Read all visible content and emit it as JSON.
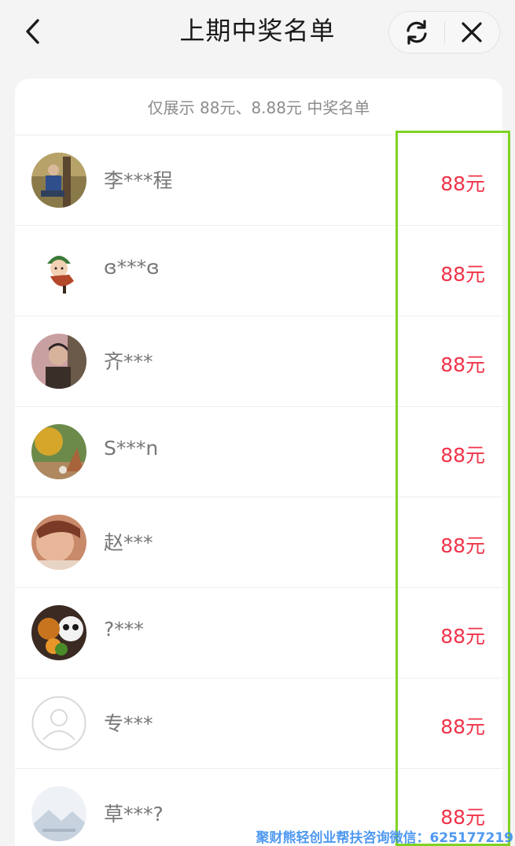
{
  "header": {
    "title": "上期中奖名单"
  },
  "note": "仅展示 88元、8.88元 中奖名单",
  "winners": [
    {
      "name": "李***程",
      "amount": "88元",
      "avatar": "photo-man-outdoor"
    },
    {
      "name": "ɞ***ɞ",
      "amount": "88元",
      "avatar": "cartoon-girl"
    },
    {
      "name": "齐***",
      "amount": "88元",
      "avatar": "photo-woman-portrait"
    },
    {
      "name": "S***n",
      "amount": "88元",
      "avatar": "photo-autumn-landscape"
    },
    {
      "name": "赵***",
      "amount": "88元",
      "avatar": "photo-child-sleeping"
    },
    {
      "name": "?***",
      "amount": "88元",
      "avatar": "photo-panda-toy"
    },
    {
      "name": "专***",
      "amount": "88元",
      "avatar": "default-user-icon"
    },
    {
      "name": "草***?",
      "amount": "88元",
      "avatar": "mountain-landscape"
    }
  ],
  "watermark": "聚财熊轻创业帮扶咨询微信：625177219",
  "colors": {
    "amount": "#f0344a",
    "highlight": "#7ed321",
    "watermark": "#3d8ff0"
  }
}
